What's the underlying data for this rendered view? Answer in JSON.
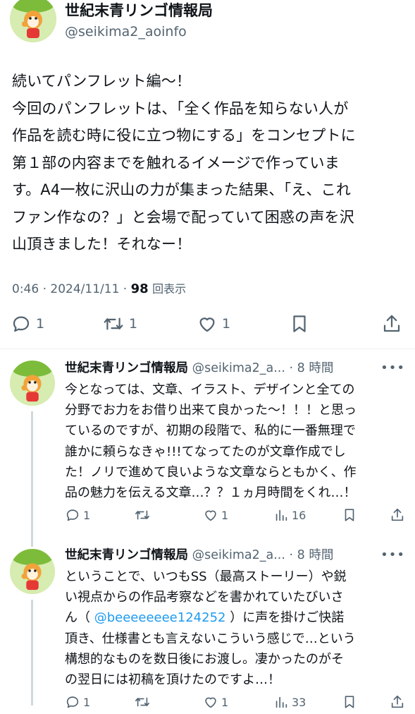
{
  "main_tweet": {
    "author_name": "世紀末青リンゴ情報局",
    "author_handle": "@seikima2_aoinfo",
    "text": "続いてパンフレット編〜！\n今回のパンフレットは、「全く作品を知らない人が\n作品を読む時に役に立つ物にする」をコンセプトに\n第１部の内容までを触れるイメージで作っていま\nす。A4一枚に沢山の力が集まった結果、「え、これ\nファン作なの？」と会場で配っていて困惑の声を沢\n山頂きました！それなー！",
    "time": "0:46",
    "date": "2024/11/11",
    "separator": "·",
    "views_count": "98",
    "views_label": "回表示",
    "reply_count": "1",
    "retweet_count": "1",
    "like_count": "1"
  },
  "replies": [
    {
      "author_name": "世紀末青リンゴ情報局",
      "author_handle": "@seikima2_a...",
      "separator": "·",
      "time_ago": "8 時間",
      "text": "今となっては、文章、イラスト、デザインと全ての\n分野でお力をお借り出来て良かった〜！！！と思っ\nているのですが、初期の段階で、私的に一番無理で\n誰かに頼らなきゃ!!!てなってたのが文章作成でし\nた！ノリで進めて良いような文章ならともかく、作\n品の魅力を伝える文章…？？１ヵ月時間をくれ…！",
      "reply_count": "1",
      "retweet_count": "",
      "like_count": "1",
      "views_count": "16"
    },
    {
      "author_name": "世紀末青リンゴ情報局",
      "author_handle": "@seikima2_a...",
      "separator": "·",
      "time_ago": "8 時間",
      "text_before": "ということで、いつもSS（最高ストーリー）や鋭\nい視点からの作品考察などを書かれていたびいさ\nん（ ",
      "mention": "@beeeeeeee124252",
      "text_after": " ）に声を掛けご快諾\n頂き、仕様書とも言えないこういう感じで…という\n構想的なものを数日後にお渡し。凄かったのがそ\nの翌日には初稿を頂けたのですよ…！",
      "reply_count": "1",
      "retweet_count": "",
      "like_count": "1",
      "views_count": "33"
    }
  ],
  "icons": {
    "reply": "reply-icon",
    "retweet": "retweet-icon",
    "like": "heart-icon",
    "bookmark": "bookmark-icon",
    "share": "share-icon",
    "views": "views-icon",
    "more": "more-icon"
  },
  "colors": {
    "text": "#0f1419",
    "secondary": "#536471",
    "link": "#1d9bf0",
    "thread_line": "#cfd9de"
  }
}
